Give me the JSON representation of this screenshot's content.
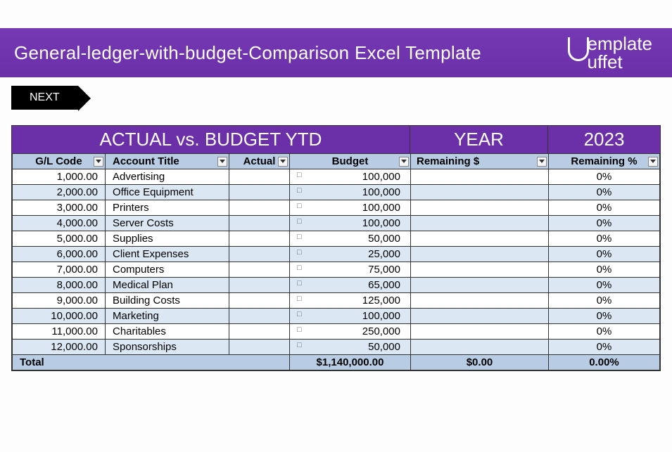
{
  "header": {
    "title": "General-ledger-with-budget-Comparison Excel Template",
    "logo_text": "emplate\nuffet"
  },
  "next_button": "NEXT",
  "sheet_title": {
    "main": "ACTUAL vs. BUDGET YTD",
    "year_label": "YEAR",
    "year_value": "2023"
  },
  "columns": {
    "gl": "G/L Code",
    "title": "Account Title",
    "actual": "Actual",
    "budget": "Budget",
    "rem_d": "Remaining $",
    "rem_p": "Remaining %"
  },
  "rows": [
    {
      "gl": "1,000.00",
      "title": "Advertising",
      "actual": "",
      "budget": "100,000",
      "rem_d": "",
      "rem_p": "0%"
    },
    {
      "gl": "2,000.00",
      "title": "Office Equipment",
      "actual": "",
      "budget": "100,000",
      "rem_d": "",
      "rem_p": "0%"
    },
    {
      "gl": "3,000.00",
      "title": "Printers",
      "actual": "",
      "budget": "100,000",
      "rem_d": "",
      "rem_p": "0%"
    },
    {
      "gl": "4,000.00",
      "title": "Server Costs",
      "actual": "",
      "budget": "100,000",
      "rem_d": "",
      "rem_p": "0%"
    },
    {
      "gl": "5,000.00",
      "title": "Supplies",
      "actual": "",
      "budget": "50,000",
      "rem_d": "",
      "rem_p": "0%"
    },
    {
      "gl": "6,000.00",
      "title": "Client Expenses",
      "actual": "",
      "budget": "25,000",
      "rem_d": "",
      "rem_p": "0%"
    },
    {
      "gl": "7,000.00",
      "title": "Computers",
      "actual": "",
      "budget": "75,000",
      "rem_d": "",
      "rem_p": "0%"
    },
    {
      "gl": "8,000.00",
      "title": "Medical Plan",
      "actual": "",
      "budget": "65,000",
      "rem_d": "",
      "rem_p": "0%"
    },
    {
      "gl": "9,000.00",
      "title": "Building Costs",
      "actual": "",
      "budget": "125,000",
      "rem_d": "",
      "rem_p": "0%"
    },
    {
      "gl": "10,000.00",
      "title": "Marketing",
      "actual": "",
      "budget": "100,000",
      "rem_d": "",
      "rem_p": "0%"
    },
    {
      "gl": "11,000.00",
      "title": "Charitables",
      "actual": "",
      "budget": "250,000",
      "rem_d": "",
      "rem_p": "0%"
    },
    {
      "gl": "12,000.00",
      "title": "Sponsorships",
      "actual": "",
      "budget": "50,000",
      "rem_d": "",
      "rem_p": "0%"
    }
  ],
  "total": {
    "label": "Total",
    "budget": "$1,140,000.00",
    "rem_d": "$0.00",
    "rem_p": "0.00%"
  },
  "currency_symbol": "□"
}
